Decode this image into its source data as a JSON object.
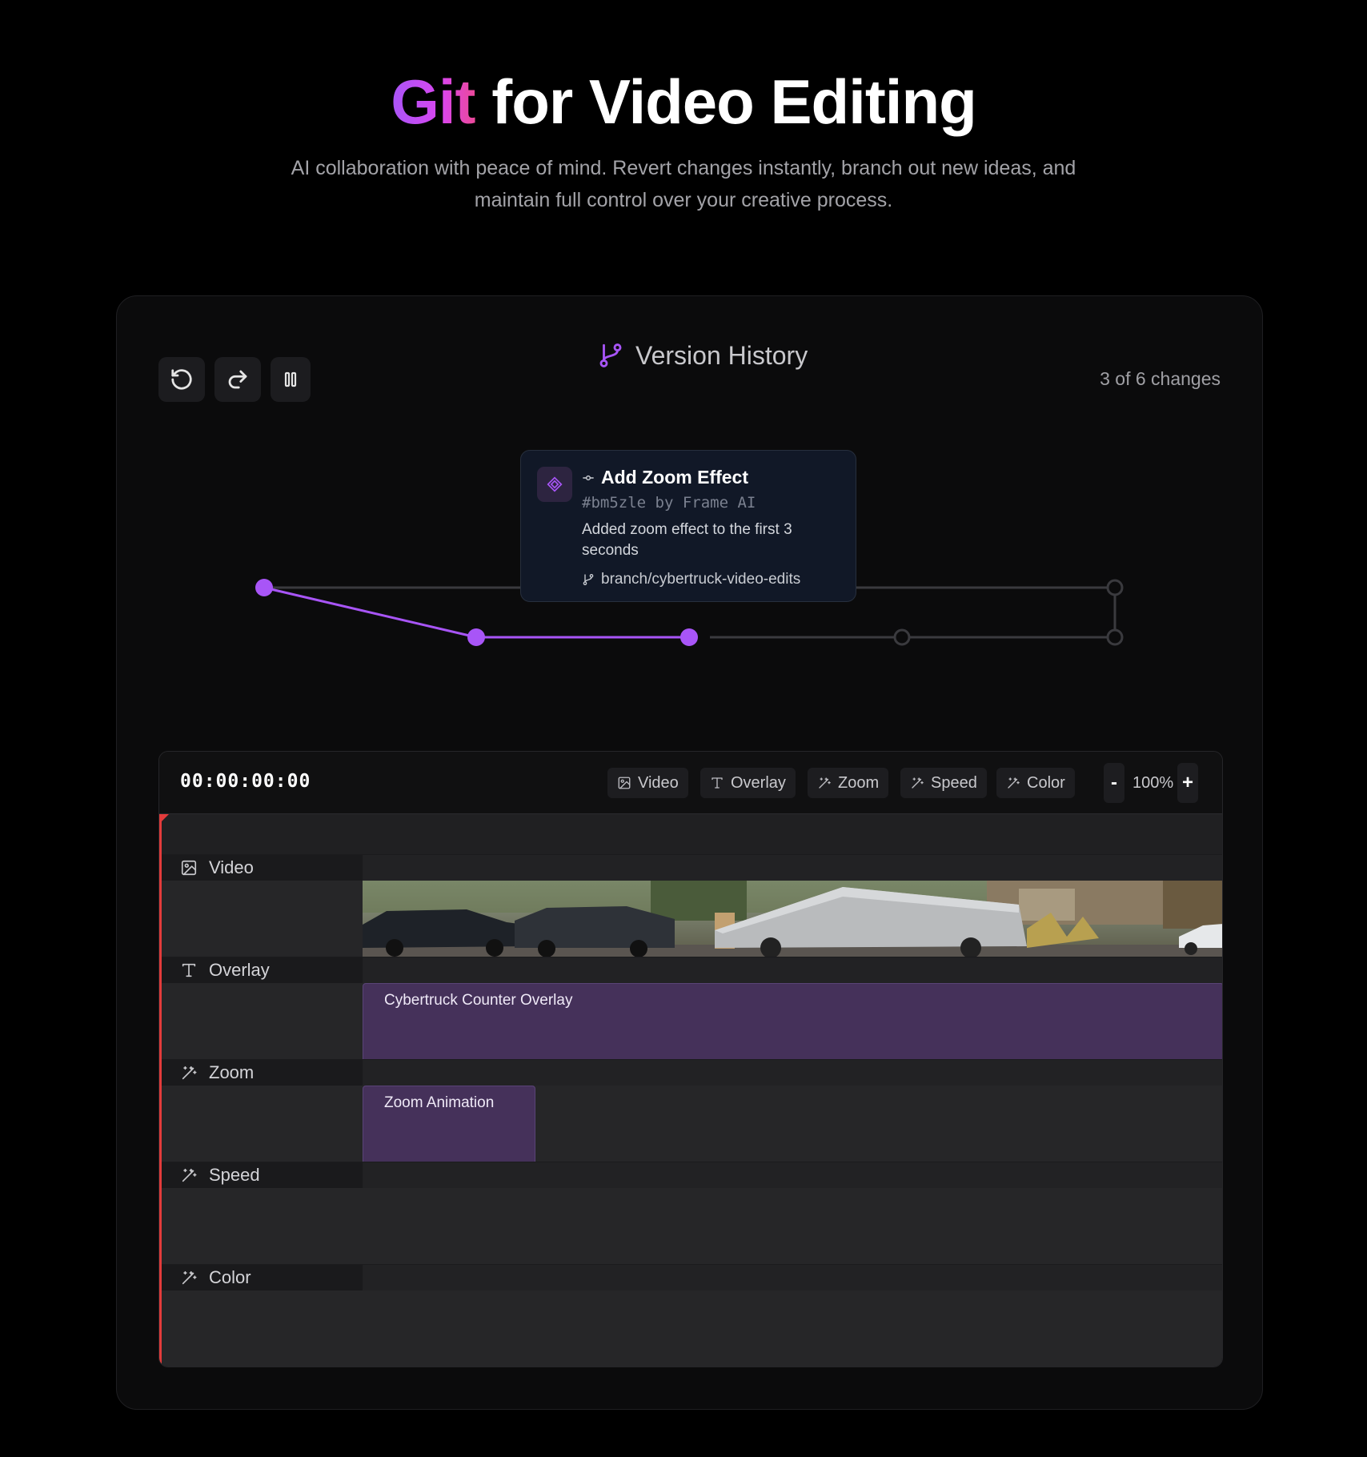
{
  "hero": {
    "title_highlight": "Git",
    "title_rest": " for Video Editing",
    "subtitle": "AI collaboration with peace of mind. Revert changes instantly, branch out new ideas, and maintain full control over your creative process."
  },
  "version_history": {
    "title": "Version History",
    "changes_label": "3 of 6 changes",
    "toolbar": {
      "undo_icon": "rotate-ccw-icon",
      "redo_icon": "redo-icon",
      "pause_icon": "pause-icon"
    },
    "tooltip": {
      "title": "Add Zoom Effect",
      "hash_line": "#bm5zle by Frame AI",
      "description": "Added zoom effect to the first 3 seconds",
      "branch": "branch/cybertruck-video-edits"
    },
    "commit_graph": {
      "active_color": "#a855f7",
      "inactive_color": "#3f3f46",
      "total_commits": 6,
      "active_commits": 3
    }
  },
  "editor": {
    "timecode": "00:00:00:00",
    "toolbar_chips": [
      "Video",
      "Overlay",
      "Zoom",
      "Speed",
      "Color"
    ],
    "zoom_minus": "-",
    "zoom_level": "100%",
    "zoom_plus": "+",
    "tracks": [
      {
        "label": "Video",
        "icon": "image-icon"
      },
      {
        "label": "Overlay",
        "icon": "text-icon"
      },
      {
        "label": "Zoom",
        "icon": "magic-wand-icon"
      },
      {
        "label": "Speed",
        "icon": "magic-wand-icon"
      },
      {
        "label": "Color",
        "icon": "magic-wand-icon"
      }
    ],
    "clips": {
      "overlay": "Cybertruck Counter Overlay",
      "zoom": "Zoom Animation"
    },
    "playhead_color": "#e23b3b",
    "clip_color": "#45315a"
  }
}
